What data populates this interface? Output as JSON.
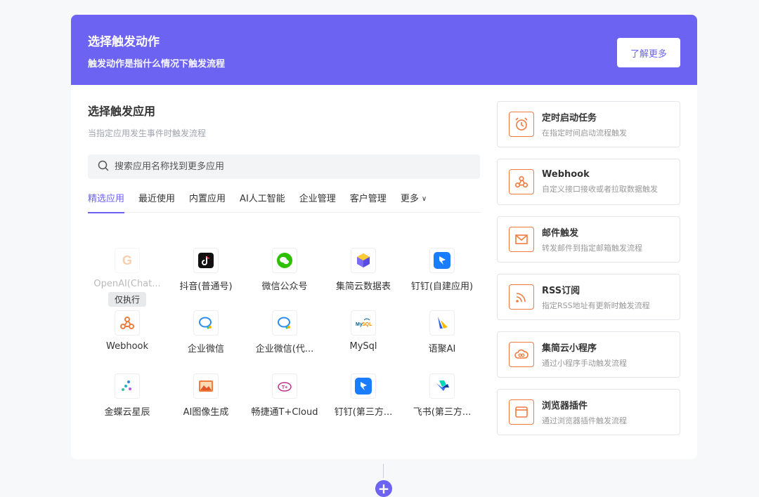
{
  "banner": {
    "title": "选择触发动作",
    "subtitle": "触发动作是指什么情况下触发流程",
    "learn_more": "了解更多"
  },
  "apps_section": {
    "title": "选择触发应用",
    "subtitle": "当指定应用发生事件时触发流程",
    "search_placeholder": "搜索应用名称找到更多应用"
  },
  "tabs": [
    {
      "label": "精选应用",
      "active": true
    },
    {
      "label": "最近使用"
    },
    {
      "label": "内置应用"
    },
    {
      "label": "AI人工智能"
    },
    {
      "label": "企业管理"
    },
    {
      "label": "客户管理"
    },
    {
      "label": "更多"
    }
  ],
  "apps": [
    {
      "name": "OpenAI(Chat...",
      "icon": "openai-g-icon",
      "badge": "仅执行",
      "disabled": true
    },
    {
      "name": "抖音(普通号)",
      "icon": "douyin-icon"
    },
    {
      "name": "微信公众号",
      "icon": "wechat-icon"
    },
    {
      "name": "集简云数据表",
      "icon": "jijianyun-table-icon"
    },
    {
      "name": "钉钉(自建应用)",
      "icon": "dingtalk-icon"
    },
    {
      "name": "Webhook",
      "icon": "webhook-icon"
    },
    {
      "name": "企业微信",
      "icon": "wecom-icon"
    },
    {
      "name": "企业微信(代...",
      "icon": "wecom-icon"
    },
    {
      "name": "MySql",
      "icon": "mysql-icon"
    },
    {
      "name": "语聚AI",
      "icon": "yuju-ai-icon"
    },
    {
      "name": "金蝶云星辰",
      "icon": "kingdee-icon"
    },
    {
      "name": "AI图像生成",
      "icon": "ai-image-icon"
    },
    {
      "name": "畅捷通T+Cloud",
      "icon": "chanjet-icon"
    },
    {
      "name": "钉钉(第三方...",
      "icon": "dingtalk-icon"
    },
    {
      "name": "飞书(第三方...",
      "icon": "feishu-icon"
    }
  ],
  "triggers": [
    {
      "title": "定时启动任务",
      "desc": "在指定时间启动流程触发",
      "icon": "alarm-clock-icon"
    },
    {
      "title": "Webhook",
      "desc": "自定义接口接收或者拉取数据触发",
      "icon": "webhook-icon"
    },
    {
      "title": "邮件触发",
      "desc": "转发邮件到指定邮箱触发流程",
      "icon": "mail-icon"
    },
    {
      "title": "RSS订阅",
      "desc": "指定RSS地址有更新时触发流程",
      "icon": "rss-icon"
    },
    {
      "title": "集简云小程序",
      "desc": "通过小程序手动触发流程",
      "icon": "cloud-icon"
    },
    {
      "title": "浏览器插件",
      "desc": "通过浏览器插件触发流程",
      "icon": "browser-icon"
    }
  ],
  "colors": {
    "accent": "#6c63f2",
    "trigger_icon": "#f07b3e"
  }
}
